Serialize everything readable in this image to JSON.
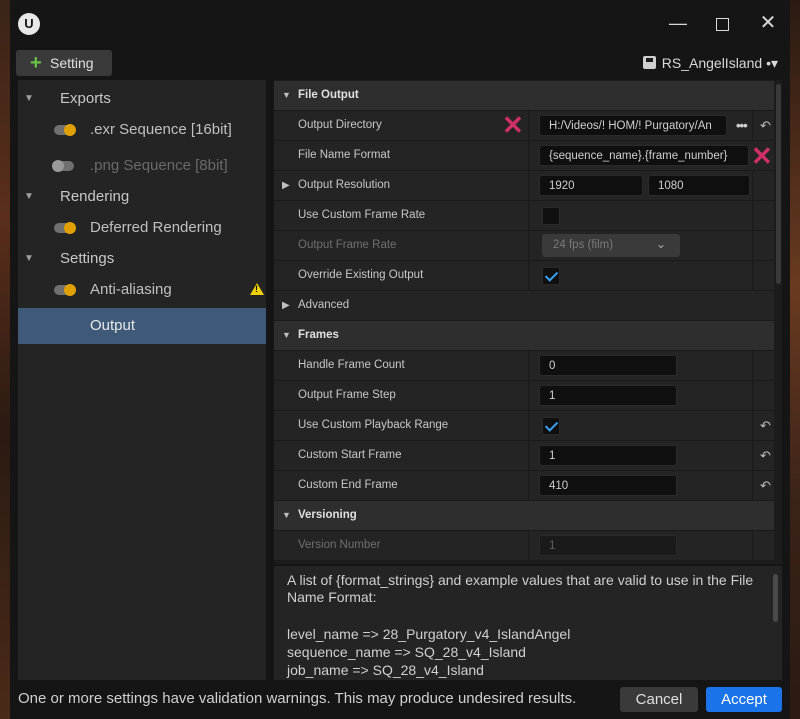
{
  "window": {
    "logo_text": "U",
    "minimize": "—",
    "close": "✕"
  },
  "toolbar": {
    "add_label": "Setting",
    "add_icon": "+",
    "preset_name": "RS_AngelIsland",
    "preset_suffix": "•▾"
  },
  "sidebar": {
    "exports_label": "Exports",
    "exr_label": ".exr Sequence [16bit]",
    "png_label": ".png Sequence [8bit]",
    "rendering_label": "Rendering",
    "deferred_label": "Deferred Rendering",
    "settings_label": "Settings",
    "antialiasing_label": "Anti-aliasing",
    "output_label": "Output",
    "warning_mark": "!"
  },
  "details": {
    "file_output": {
      "header": "File Output",
      "output_directory_label": "Output Directory",
      "output_directory_value": "H:/Videos/! HOM/! Purgatory/An",
      "browse": "•••",
      "file_name_format_label": "File Name Format",
      "file_name_format_value": "{sequence_name}.{frame_number}",
      "output_resolution_label": "Output Resolution",
      "resolution_x": "1920",
      "resolution_y": "1080",
      "use_custom_frame_rate_label": "Use Custom Frame Rate",
      "output_frame_rate_label": "Output Frame Rate",
      "output_frame_rate_value": "24 fps (film)",
      "override_existing_output_label": "Override Existing Output",
      "advanced_label": "Advanced"
    },
    "frames": {
      "header": "Frames",
      "handle_frame_count_label": "Handle Frame Count",
      "handle_frame_count_value": "0",
      "output_frame_step_label": "Output Frame Step",
      "output_frame_step_value": "1",
      "use_custom_playback_range_label": "Use Custom Playback Range",
      "custom_start_frame_label": "Custom Start Frame",
      "custom_start_frame_value": "1",
      "custom_end_frame_label": "Custom End Frame",
      "custom_end_frame_value": "410"
    },
    "versioning": {
      "header": "Versioning",
      "version_number_label": "Version Number",
      "version_number_value": "1"
    },
    "reset_icon": "↶",
    "annotation_mark": "✕"
  },
  "description": {
    "intro": "A list of {format_strings} and example values that are valid to use in the File Name Format:",
    "level_name": "level_name => 28_Purgatory_v4_IslandAngel",
    "sequence_name": "sequence_name => SQ_28_v4_Island",
    "job_name": "job_name => SQ_28_v4_Island"
  },
  "footer": {
    "message": "One or more settings have validation warnings. This may produce undesired results.",
    "cancel_label": "Cancel",
    "accept_label": "Accept"
  },
  "colors": {
    "accent": "#1a73e8",
    "selection": "#3e5a78",
    "toggle_on": "#e0a000",
    "warning": "#f0d000",
    "annotation": "#d0306a",
    "add_plus": "#6ac447"
  }
}
